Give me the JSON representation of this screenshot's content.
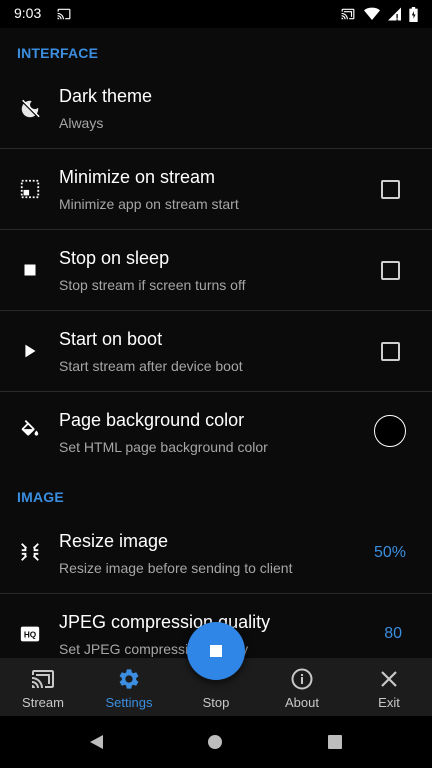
{
  "status_bar": {
    "time": "9:03"
  },
  "sections": {
    "interface": "INTERFACE",
    "image": "IMAGE"
  },
  "prefs": {
    "dark_theme": {
      "title": "Dark theme",
      "summary": "Always",
      "icon": "theme-icon"
    },
    "minimize_on_stream": {
      "title": "Minimize on stream",
      "summary": "Minimize app on stream start",
      "icon": "minimize-icon",
      "checked": false
    },
    "stop_on_sleep": {
      "title": "Stop on sleep",
      "summary": "Stop stream if screen turns off",
      "icon": "stop-icon",
      "checked": false
    },
    "start_on_boot": {
      "title": "Start on boot",
      "summary": "Start stream after device boot",
      "icon": "play-icon",
      "checked": false
    },
    "page_bg_color": {
      "title": "Page background color",
      "summary": "Set HTML page background color",
      "icon": "paint-bucket-icon",
      "color": "#000000"
    },
    "resize_image": {
      "title": "Resize image",
      "summary": "Resize image before sending to client",
      "value": "50%",
      "icon": "resize-icon"
    },
    "jpeg_quality": {
      "title": "JPEG compression quality",
      "summary": "Set JPEG compression quality",
      "value": "80",
      "icon": "hq-icon"
    }
  },
  "bottom_nav": {
    "items": [
      {
        "label": "Stream",
        "icon": "cast-icon"
      },
      {
        "label": "Settings",
        "icon": "gear-icon",
        "active": true
      },
      {
        "label": "Stop",
        "icon": "stop-icon"
      },
      {
        "label": "About",
        "icon": "info-icon"
      },
      {
        "label": "Exit",
        "icon": "close-icon"
      }
    ]
  },
  "colors": {
    "accent": "#3b8ee0",
    "fab": "#2f86e6",
    "background": "#0b0b0b",
    "nav_background": "#1c1c1c"
  }
}
